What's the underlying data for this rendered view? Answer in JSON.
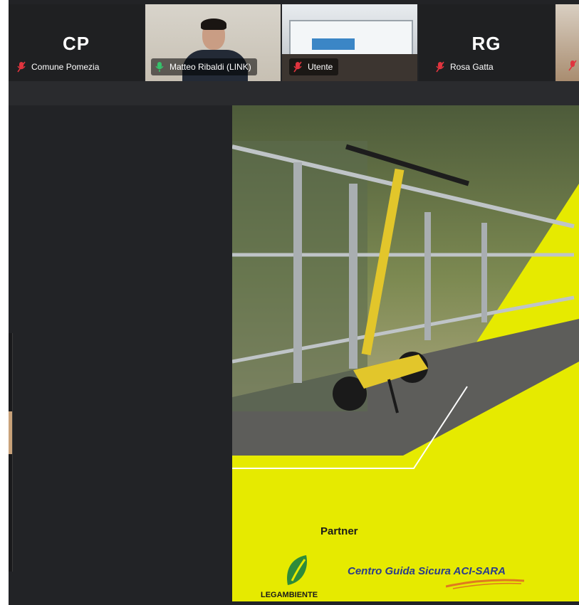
{
  "participants": [
    {
      "initials": "CP",
      "name": "Comune Pomezia",
      "muted": true
    },
    {
      "initials": "",
      "name": "Matteo Ribaldi (LINK)",
      "muted": false
    },
    {
      "initials": "",
      "name": "Utente",
      "muted": true
    },
    {
      "initials": "RG",
      "name": "Rosa Gatta",
      "muted": true
    }
  ],
  "slide": {
    "partner_label": "Partner",
    "logo1_text": "LEGAMBIENTE",
    "logo2_text": "Centro Guida Sicura ACI-SARA"
  },
  "colors": {
    "app_bg": "#222326",
    "slide_yellow": "#e6ea00",
    "mic_muted": "#e0343e",
    "mic_active": "#35c26b"
  }
}
